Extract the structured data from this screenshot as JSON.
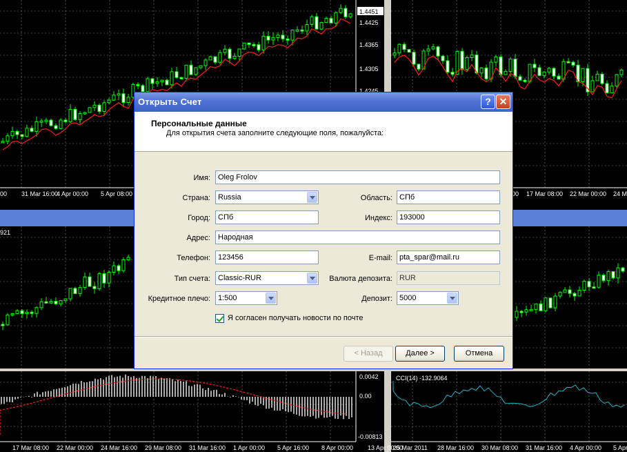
{
  "chart_data": [
    {
      "type": "candlestick",
      "price_scale": [
        "1.4451",
        "1.4425",
        "1.4365",
        "1.4305",
        "1.4245"
      ],
      "x_ticks": [
        "00",
        "31 Mar 16:00",
        "4 Apr 00:00",
        "5 Apr 08:00"
      ]
    },
    {
      "type": "candlestick",
      "x_ticks": [
        "00",
        "17 Mar 08:00",
        "22 Mar 00:00",
        "24 M"
      ]
    },
    {
      "type": "candlestick",
      "price_scale": [
        "921"
      ]
    },
    {
      "type": "candlestick"
    },
    {
      "type": "bar",
      "indicator": "oscillator",
      "price_scale": [
        "0.0042",
        "0.00",
        "-0.00813"
      ],
      "x_ticks": [
        "17 Mar 08:00",
        "22 Mar 00:00",
        "24 Mar 16:00",
        "29 Mar 08:00",
        "31 Mar 16:00",
        "1 Apr 00:00",
        "5 Apr 16:00",
        "8 Apr 00:00",
        "13 Apr 00:00"
      ]
    },
    {
      "type": "line",
      "indicator": "CCI(14) -132.9064",
      "x_ticks": [
        "25 Mar 2011",
        "28 Mar 16:00",
        "30 Mar 08:00",
        "31 Mar 16:00",
        "4 Apr 00:00",
        "5 Apr"
      ]
    }
  ],
  "dialog": {
    "title": "Открыть Счет",
    "help_label": "?",
    "close_label": "✕",
    "header_title": "Персональные данные",
    "header_subtitle": "Для открытия счета заполните следующие поля, пожалуйста:",
    "fields": {
      "name": {
        "label": "Имя:",
        "value": "Oleg Frolov"
      },
      "country": {
        "label": "Страна:",
        "value": "Russia"
      },
      "region": {
        "label": "Область:",
        "value": "СПб"
      },
      "city": {
        "label": "Город:",
        "value": "СПб"
      },
      "zip": {
        "label": "Индекс:",
        "value": "193000"
      },
      "address": {
        "label": "Адрес:",
        "value": "Народная"
      },
      "phone": {
        "label": "Телефон:",
        "value": "123456"
      },
      "email": {
        "label": "E-mail:",
        "value": "pta_spar@mail.ru"
      },
      "account_type": {
        "label": "Тип счета:",
        "value": "Classic-RUR"
      },
      "currency": {
        "label": "Валюта депозита:",
        "value": "RUR"
      },
      "leverage": {
        "label": "Кредитное плечо:",
        "value": "1:500"
      },
      "deposit": {
        "label": "Депозит:",
        "value": "5000"
      }
    },
    "newsletter": {
      "label": "Я согласен получать новости по почте",
      "checked": true
    },
    "buttons": {
      "back": "< Назад",
      "next": "Далее >",
      "cancel": "Отмена"
    }
  }
}
